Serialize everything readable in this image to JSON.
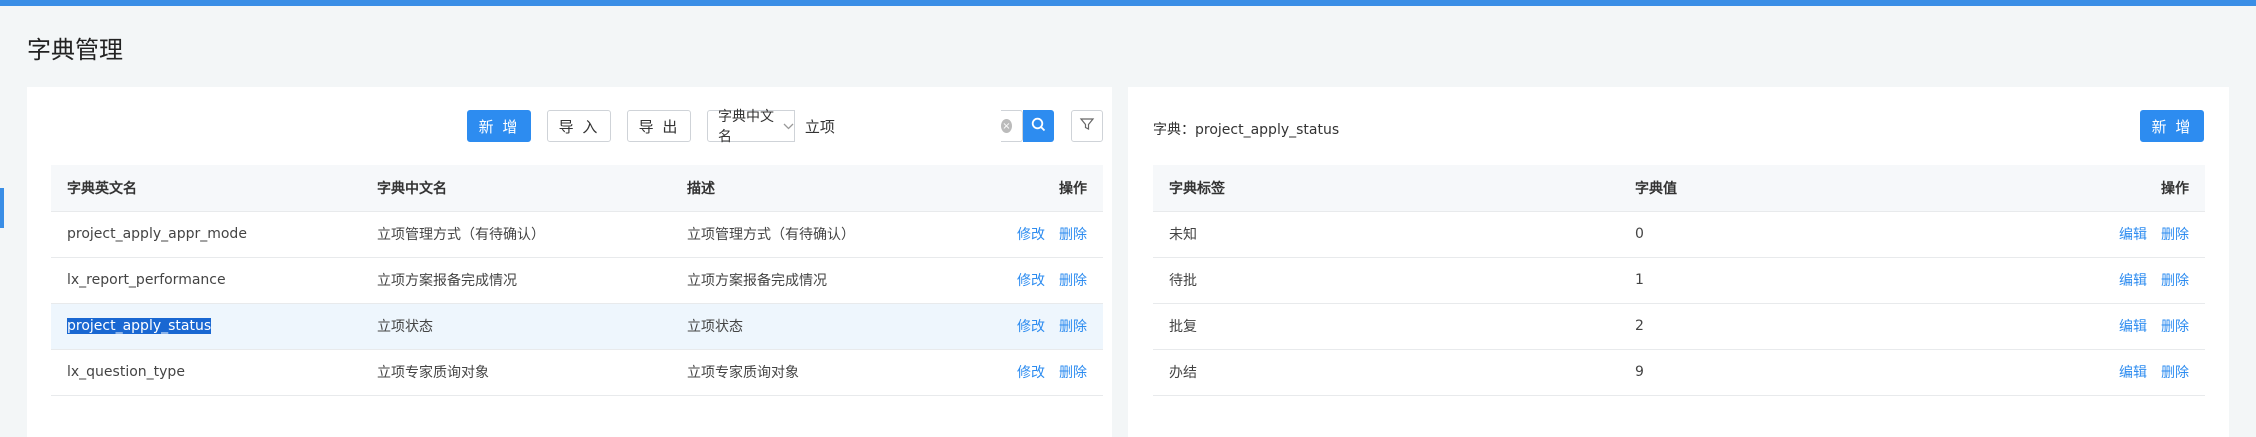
{
  "page_title": "字典管理",
  "left": {
    "buttons": {
      "new": "新 增",
      "import": "导 入",
      "export": "导 出"
    },
    "search": {
      "field": "字典中文名",
      "value": "立项"
    },
    "columns": [
      "字典英文名",
      "字典中文名",
      "描述",
      "操作"
    ],
    "rows": [
      {
        "en": "project_apply_appr_mode",
        "cn": "立项管理方式（有待确认）",
        "desc": "立项管理方式（有待确认）",
        "edit": "修改",
        "del": "删除"
      },
      {
        "en": "lx_report_performance",
        "cn": "立项方案报备完成情况",
        "desc": "立项方案报备完成情况",
        "edit": "修改",
        "del": "删除"
      },
      {
        "en": "project_apply_status",
        "cn": "立项状态",
        "desc": "立项状态",
        "edit": "修改",
        "del": "删除"
      },
      {
        "en": "lx_question_type",
        "cn": "立项专家质询对象",
        "desc": "立项专家质询对象",
        "edit": "修改",
        "del": "删除"
      }
    ]
  },
  "right": {
    "dict_label": "字典：project_apply_status",
    "new_button": "新 增",
    "columns": [
      "字典标签",
      "字典值",
      "操作"
    ],
    "rows": [
      {
        "label": "未知",
        "value": "0",
        "edit": "编辑",
        "del": "删除"
      },
      {
        "label": "待批",
        "value": "1",
        "edit": "编辑",
        "del": "删除"
      },
      {
        "label": "批复",
        "value": "2",
        "edit": "编辑",
        "del": "删除"
      },
      {
        "label": "办结",
        "value": "9",
        "edit": "编辑",
        "del": "删除"
      }
    ]
  },
  "colors": {
    "primary": "#2d8cf0",
    "topbar": "#3a8ee6",
    "selected_row": "#eef6fd"
  },
  "icons": [
    "search-icon",
    "filter-icon",
    "clear-icon",
    "chevron-down-icon"
  ]
}
